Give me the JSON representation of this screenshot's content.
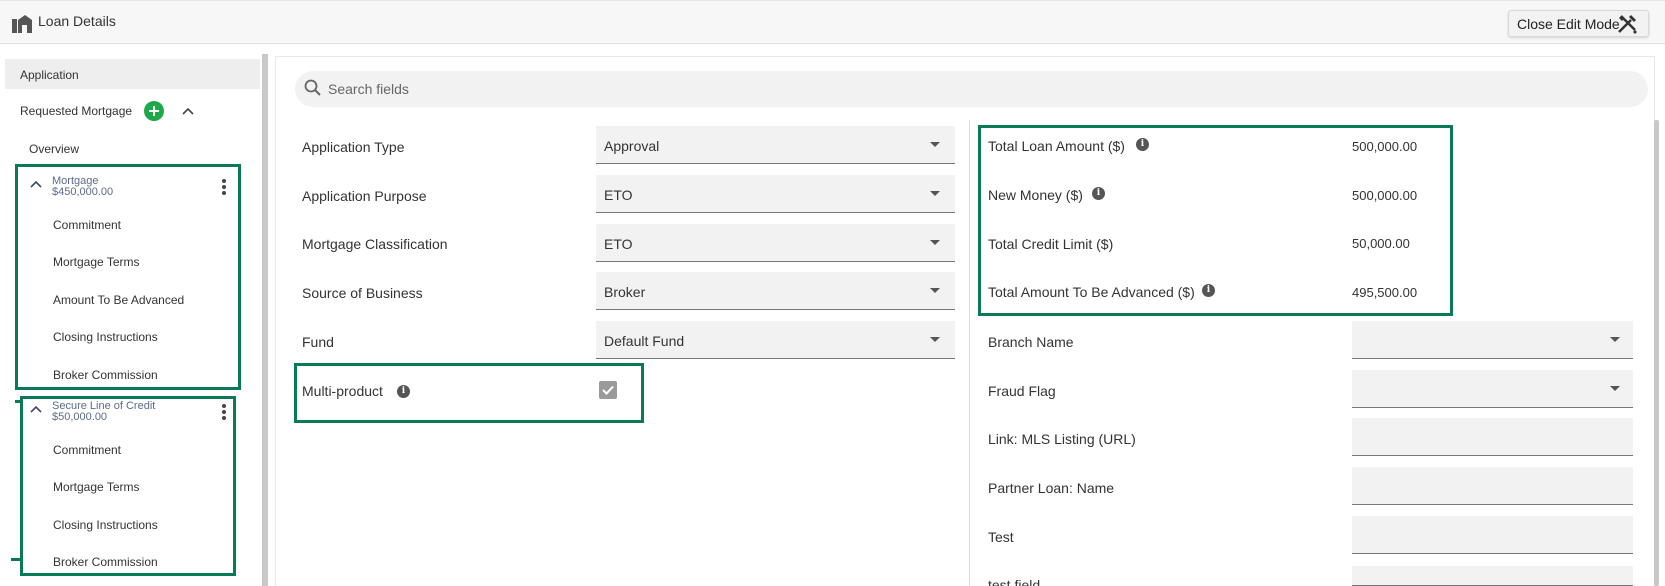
{
  "header": {
    "title": "Loan Details",
    "close_edit_label": "Close Edit Mode",
    "logo_icon": "house-logo-icon",
    "close_icon": "tools-icon"
  },
  "sidebar": {
    "application": "Application",
    "requested_mortgage": "Requested Mortgage",
    "overview": "Overview",
    "products": [
      {
        "name": "Mortgage",
        "amount": "$450,000.00",
        "items": [
          "Commitment",
          "Mortgage Terms",
          "Amount To Be Advanced",
          "Closing Instructions",
          "Broker Commission"
        ]
      },
      {
        "name": "Secure Line of Credit",
        "amount": "$50,000.00",
        "items": [
          "Commitment",
          "Mortgage Terms",
          "Closing Instructions",
          "Broker Commission"
        ]
      }
    ]
  },
  "search": {
    "placeholder": "Search fields"
  },
  "left_fields": [
    {
      "label": "Application Type",
      "value": "Approval"
    },
    {
      "label": "Application Purpose",
      "value": "ETO"
    },
    {
      "label": "Mortgage Classification",
      "value": "ETO"
    },
    {
      "label": "Source of Business",
      "value": "Broker"
    },
    {
      "label": "Fund",
      "value": "Default Fund"
    }
  ],
  "multi_product": {
    "label": "Multi-product",
    "checked": true
  },
  "totals": [
    {
      "label": "Total Loan Amount ($)",
      "value": "500,000.00"
    },
    {
      "label": "New Money ($)",
      "value": "500,000.00"
    },
    {
      "label": "Total Credit Limit ($)",
      "value": "50,000.00"
    },
    {
      "label": "Total Amount To Be Advanced ($)",
      "value": "495,500.00"
    }
  ],
  "right_fields": [
    {
      "label": "Branch Name",
      "value": ""
    },
    {
      "label": "Fraud Flag",
      "value": ""
    },
    {
      "label": "Link: MLS Listing (URL)",
      "value": ""
    },
    {
      "label": "Partner Loan: Name",
      "value": ""
    },
    {
      "label": "Test",
      "value": ""
    },
    {
      "label": "test field",
      "value": ""
    }
  ],
  "colors": {
    "accent_green": "#0a7a52",
    "add_green": "#1fa84a"
  }
}
